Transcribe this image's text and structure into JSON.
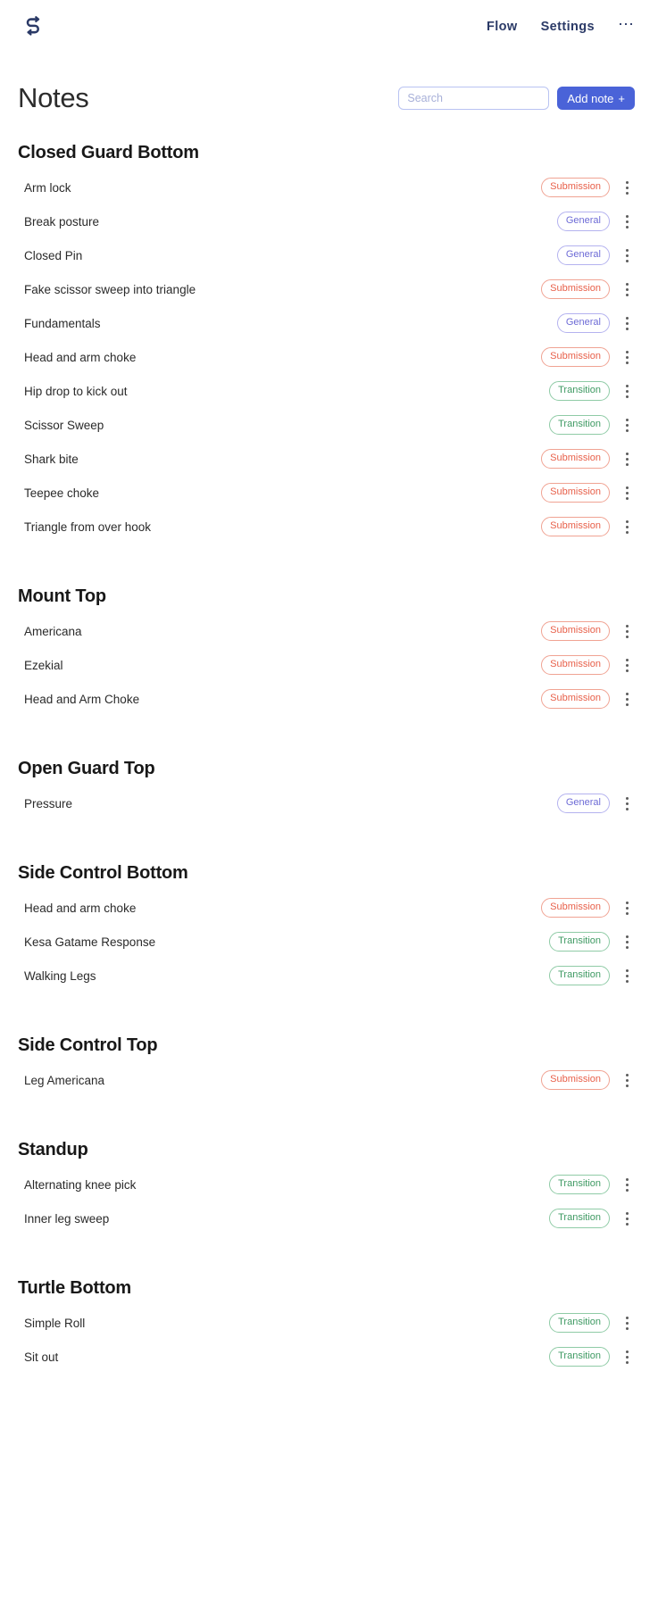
{
  "app": {
    "logo_icon": "flow-snake-logo-icon",
    "brand_color": "#2b3a67"
  },
  "nav": {
    "links": [
      {
        "label": "Flow"
      },
      {
        "label": "Settings"
      }
    ],
    "overflow_label": "⋯"
  },
  "header": {
    "title": "Notes",
    "search": {
      "placeholder": "Search",
      "value": ""
    },
    "add_button": {
      "label": "Add note",
      "plus": "+"
    }
  },
  "colors": {
    "accent": "#4a63d8",
    "submission": "#e8604a",
    "general": "#6d6bd6",
    "transition": "#3f9a63"
  },
  "badges": {
    "submission": "Submission",
    "general": "General",
    "transition": "Transition"
  },
  "row_menu_icon": "kebab-menu-icon",
  "sections": [
    {
      "title": "Closed Guard Bottom",
      "notes": [
        {
          "name": "Arm lock",
          "tag": "Submission",
          "tag_type": "submission"
        },
        {
          "name": "Break posture",
          "tag": "General",
          "tag_type": "general"
        },
        {
          "name": "Closed Pin",
          "tag": "General",
          "tag_type": "general"
        },
        {
          "name": "Fake scissor sweep into triangle",
          "tag": "Submission",
          "tag_type": "submission"
        },
        {
          "name": "Fundamentals",
          "tag": "General",
          "tag_type": "general"
        },
        {
          "name": "Head and arm choke",
          "tag": "Submission",
          "tag_type": "submission"
        },
        {
          "name": "Hip drop to kick out",
          "tag": "Transition",
          "tag_type": "transition"
        },
        {
          "name": "Scissor Sweep",
          "tag": "Transition",
          "tag_type": "transition"
        },
        {
          "name": "Shark bite",
          "tag": "Submission",
          "tag_type": "submission"
        },
        {
          "name": "Teepee choke",
          "tag": "Submission",
          "tag_type": "submission"
        },
        {
          "name": "Triangle from over hook",
          "tag": "Submission",
          "tag_type": "submission"
        }
      ]
    },
    {
      "title": "Mount Top",
      "notes": [
        {
          "name": "Americana",
          "tag": "Submission",
          "tag_type": "submission"
        },
        {
          "name": "Ezekial",
          "tag": "Submission",
          "tag_type": "submission"
        },
        {
          "name": "Head and Arm Choke",
          "tag": "Submission",
          "tag_type": "submission"
        }
      ]
    },
    {
      "title": "Open Guard Top",
      "notes": [
        {
          "name": "Pressure",
          "tag": "General",
          "tag_type": "general"
        }
      ]
    },
    {
      "title": "Side Control Bottom",
      "notes": [
        {
          "name": "Head and arm choke",
          "tag": "Submission",
          "tag_type": "submission"
        },
        {
          "name": "Kesa Gatame Response",
          "tag": "Transition",
          "tag_type": "transition"
        },
        {
          "name": "Walking Legs",
          "tag": "Transition",
          "tag_type": "transition"
        }
      ]
    },
    {
      "title": "Side Control Top",
      "notes": [
        {
          "name": "Leg Americana",
          "tag": "Submission",
          "tag_type": "submission"
        }
      ]
    },
    {
      "title": "Standup",
      "notes": [
        {
          "name": "Alternating knee pick",
          "tag": "Transition",
          "tag_type": "transition"
        },
        {
          "name": "Inner leg sweep",
          "tag": "Transition",
          "tag_type": "transition"
        }
      ]
    },
    {
      "title": "Turtle Bottom",
      "notes": [
        {
          "name": "Simple Roll",
          "tag": "Transition",
          "tag_type": "transition"
        },
        {
          "name": "Sit out",
          "tag": "Transition",
          "tag_type": "transition"
        }
      ]
    }
  ]
}
